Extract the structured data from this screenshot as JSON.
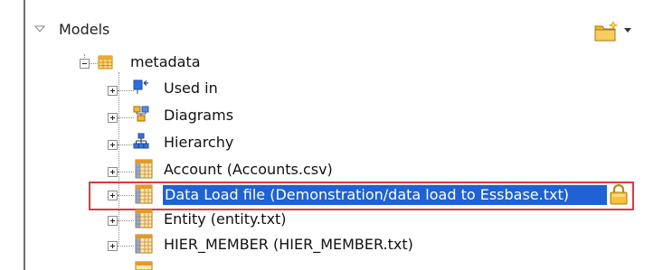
{
  "panel": {
    "title": "Models"
  },
  "tree": {
    "root": {
      "label": "metadata",
      "expanded": true
    },
    "items": [
      {
        "label": "Used in",
        "icon": "used-in-icon"
      },
      {
        "label": "Diagrams",
        "icon": "diagrams-icon"
      },
      {
        "label": "Hierarchy",
        "icon": "hierarchy-icon"
      },
      {
        "label": "Account (Accounts.csv)",
        "icon": "table-icon"
      },
      {
        "label": "Data Load file (Demonstration/data load to Essbase.txt)",
        "icon": "table-icon",
        "selected": true,
        "locked": true
      },
      {
        "label": "Entity (entity.txt)",
        "icon": "table-icon"
      },
      {
        "label": "HIER_MEMBER (HIER_MEMBER.txt)",
        "icon": "table-icon"
      }
    ]
  },
  "colors": {
    "selection": "#1f62d3",
    "highlight_border": "#e0383c",
    "lock": "#e8b423"
  }
}
